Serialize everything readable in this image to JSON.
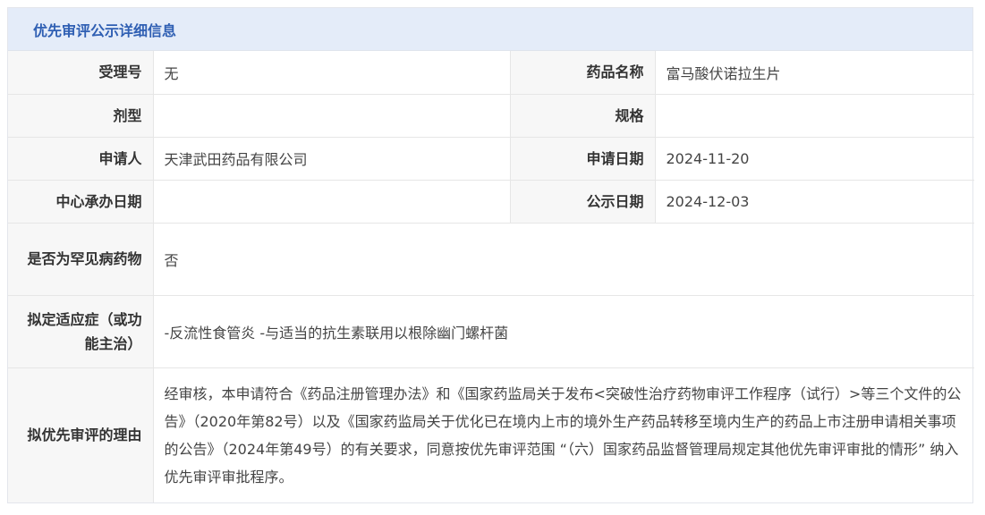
{
  "panel": {
    "title": "优先审评公示详细信息"
  },
  "fields": {
    "accept_no": {
      "label": "受理号",
      "value": "无"
    },
    "drug_name": {
      "label": "药品名称",
      "value": "富马酸伏诺拉生片"
    },
    "dosage_form": {
      "label": "剂型",
      "value": ""
    },
    "spec": {
      "label": "规格",
      "value": ""
    },
    "applicant": {
      "label": "申请人",
      "value": "天津武田药品有限公司"
    },
    "apply_date": {
      "label": "申请日期",
      "value": "2024-11-20"
    },
    "center_date": {
      "label": "中心承办日期",
      "value": ""
    },
    "publish_date": {
      "label": "公示日期",
      "value": "2024-12-03"
    },
    "rare_disease": {
      "label": "是否为罕见病药物",
      "value": "否"
    },
    "indication": {
      "label": "拟定适应症（或功能主治）",
      "value": "-反流性食管炎 -与适当的抗生素联用以根除幽门螺杆菌"
    },
    "reason": {
      "label": "拟优先审评的理由",
      "value": "经审核，本申请符合《药品注册管理办法》和《国家药监局关于发布<突破性治疗药物审评工作程序（试行）>等三个文件的公告》（2020年第82号）以及《国家药监局关于优化已在境内上市的境外生产药品转移至境内生产的药品上市注册申请相关事项的公告》（2024年第49号）的有关要求，同意按优先审评范围 “（六）国家药品监督管理局规定其他优先审评审批的情形” 纳入优先审评审批程序。"
    }
  }
}
